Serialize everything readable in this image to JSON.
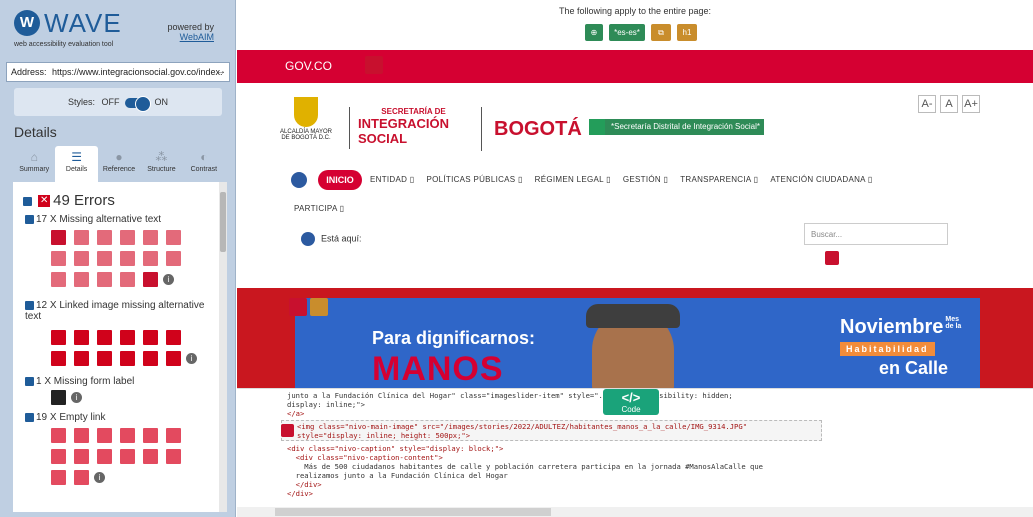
{
  "app": {
    "logo_letter": "W",
    "name": "WAVE",
    "tagline": "web accessibility evaluation tool",
    "powered_by": "powered by",
    "powered_link": "WebAIM"
  },
  "address": {
    "label": "Address:",
    "value": "https://www.integracionsocial.gov.co/index.",
    "go": "→"
  },
  "styles": {
    "label": "Styles:",
    "off": "OFF",
    "on": "ON"
  },
  "details": {
    "title": "Details",
    "tabs": [
      "Summary",
      "Details",
      "Reference",
      "Structure",
      "Contrast"
    ],
    "active_tab": "Details"
  },
  "errors": {
    "header": "49 Errors",
    "categories": [
      {
        "label": "17 X Missing alternative text",
        "count": 17
      },
      {
        "label": "12 X Linked image missing alternative text",
        "count": 12
      },
      {
        "label": "1 X Missing form label",
        "count": 1
      },
      {
        "label": "19 X Empty link",
        "count": 19
      }
    ]
  },
  "page": {
    "applies": "The following apply to the entire page:",
    "lang_badge": "*es-es*",
    "heading_badge": "h1",
    "gov": "GOV.CO",
    "escudo": "ALCALDÍA MAYOR DE BOGOTÁ D.C.",
    "secretaria": "SECRETARÍA DE",
    "integracion": "INTEGRACIÓN SOCIAL",
    "bogota": "BOGOTÁ",
    "sds": "*Secretaría Distrital de Integración Social*",
    "fonts": [
      "A-",
      "A",
      "A+"
    ],
    "inicio": "INICIO",
    "menu": [
      "ENTIDAD ▯",
      "POLÍTICAS PÚBLICAS ▯",
      "RÉGIMEN LEGAL ▯",
      "GESTIÓN ▯",
      "TRANSPARENCIA ▯",
      "ATENCIÓN CIUDADANA ▯"
    ],
    "participa": "PARTICIPA ▯",
    "esta_aqui": "Está aquí:",
    "search_placeholder": "Buscar...",
    "banner": {
      "line1": "Para dignificarnos:",
      "line2": "MANOS",
      "mes": "Noviembre",
      "mes_small": "Mes de la",
      "hab": "Habitabilidad",
      "calle": "en Calle"
    }
  },
  "code": {
    "button": "</>",
    "button_label": "Code",
    "lines": [
      "junto a la Fundación Clínica del Hogar\" class=\"imageslider-item\" style=\"...; 750px; visibility: hidden;",
      "display: inline;\">",
      "</a>",
      "<img class=\"nivo-main-image\" src=\"/images/stories/2022/ADULTEZ/habitantes_manos_a_la_calle/IMG_9314.JPG\"",
      "style=\"display: inline; height: 500px;\">",
      "<div class=\"nivo-caption\" style=\"display: block;\">",
      "  <div class=\"nivo-caption-content\">",
      "    Más de 500 ciudadanos habitantes de calle y población carretera participa en la jornada #ManosAlaCalle que",
      "  realizamos junto a la Fundación Clínica del Hogar",
      "  </div>",
      "</div>"
    ]
  }
}
